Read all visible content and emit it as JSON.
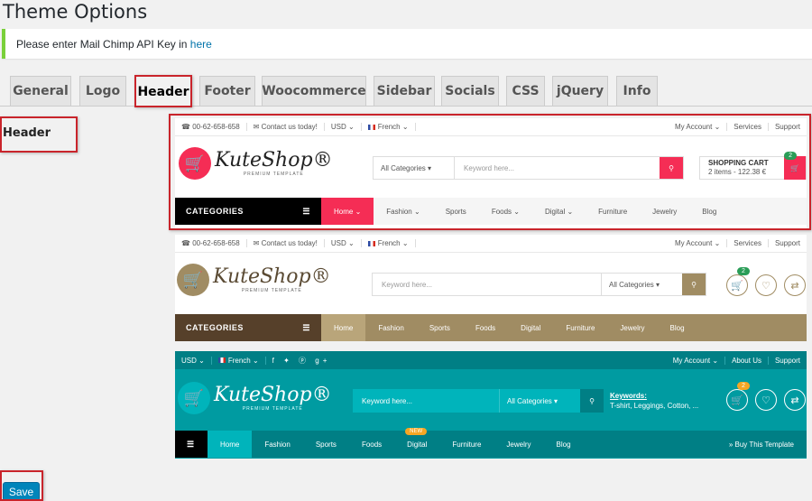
{
  "page": {
    "title": "Theme Options"
  },
  "notice": {
    "text": "Please enter Mail Chimp API Key in ",
    "link": "here"
  },
  "tabs": [
    {
      "label": "General"
    },
    {
      "label": "Logo"
    },
    {
      "label": "Header"
    },
    {
      "label": "Footer"
    },
    {
      "label": "Woocommerce"
    },
    {
      "label": "Sidebar"
    },
    {
      "label": "Socials"
    },
    {
      "label": "CSS"
    },
    {
      "label": "jQuery"
    },
    {
      "label": "Info"
    }
  ],
  "active_tab": "Header",
  "section": {
    "label": "Header"
  },
  "previews": [
    {
      "topbar": {
        "phone": "00-62-658-658",
        "contact": "Contact us today!",
        "currency": "USD",
        "language": "French",
        "account": "My Account",
        "services": "Services",
        "support": "Support"
      },
      "logo": {
        "text": "KuteShop",
        "sub": "PREMIUM TEMPLATE"
      },
      "search": {
        "category": "All Categories",
        "placeholder": "Keyword here..."
      },
      "cart": {
        "title": "SHOPPING CART",
        "items": "2 items - 122.38 €",
        "count": "2"
      },
      "nav": {
        "categories": "CATEGORIES",
        "items": [
          "Home",
          "Fashion",
          "Sports",
          "Foods",
          "Digital",
          "Furniture",
          "Jewelry",
          "Blog"
        ]
      },
      "colors": {
        "accent": "#f52d55",
        "bar": "#000000",
        "bg": "#f5f5f5"
      }
    },
    {
      "topbar": {
        "phone": "00-62-658-658",
        "contact": "Contact us today!",
        "currency": "USD",
        "language": "French",
        "account": "My Account",
        "services": "Services",
        "support": "Support"
      },
      "logo": {
        "text": "KuteShop",
        "sub": "PREMIUM TEMPLATE"
      },
      "search": {
        "category": "All Categories",
        "placeholder": "Keyword here..."
      },
      "cart": {
        "count": "2"
      },
      "nav": {
        "categories": "CATEGORIES",
        "items": [
          "Home",
          "Fashion",
          "Sports",
          "Foods",
          "Digital",
          "Furniture",
          "Jewelry",
          "Blog"
        ]
      },
      "colors": {
        "accent": "#a08c63",
        "bar": "#56402a",
        "active": "#b9a57a"
      }
    },
    {
      "topbar": {
        "currency": "USD",
        "language": "French",
        "account": "My Account",
        "about": "About Us",
        "support": "Support"
      },
      "logo": {
        "text": "KuteShop",
        "sub": "PREMIUM TEMPLATE"
      },
      "search": {
        "category": "All Categories",
        "placeholder": "Keyword here..."
      },
      "keywords": {
        "title": "Keywords:",
        "list": "T-shirt, Leggings, Cotton, ..."
      },
      "cart": {
        "count": "2"
      },
      "nav": {
        "items": [
          "Home",
          "Fashion",
          "Sports",
          "Foods",
          "Digital",
          "Furniture",
          "Jewelry",
          "Blog"
        ],
        "new_badge": "NEW",
        "buy": "» Buy This Template"
      },
      "colors": {
        "accent": "#009ba1",
        "dark": "#007f85",
        "active": "#00b4bb",
        "badge": "#f5a623"
      }
    }
  ],
  "actions": {
    "save": "Save"
  }
}
